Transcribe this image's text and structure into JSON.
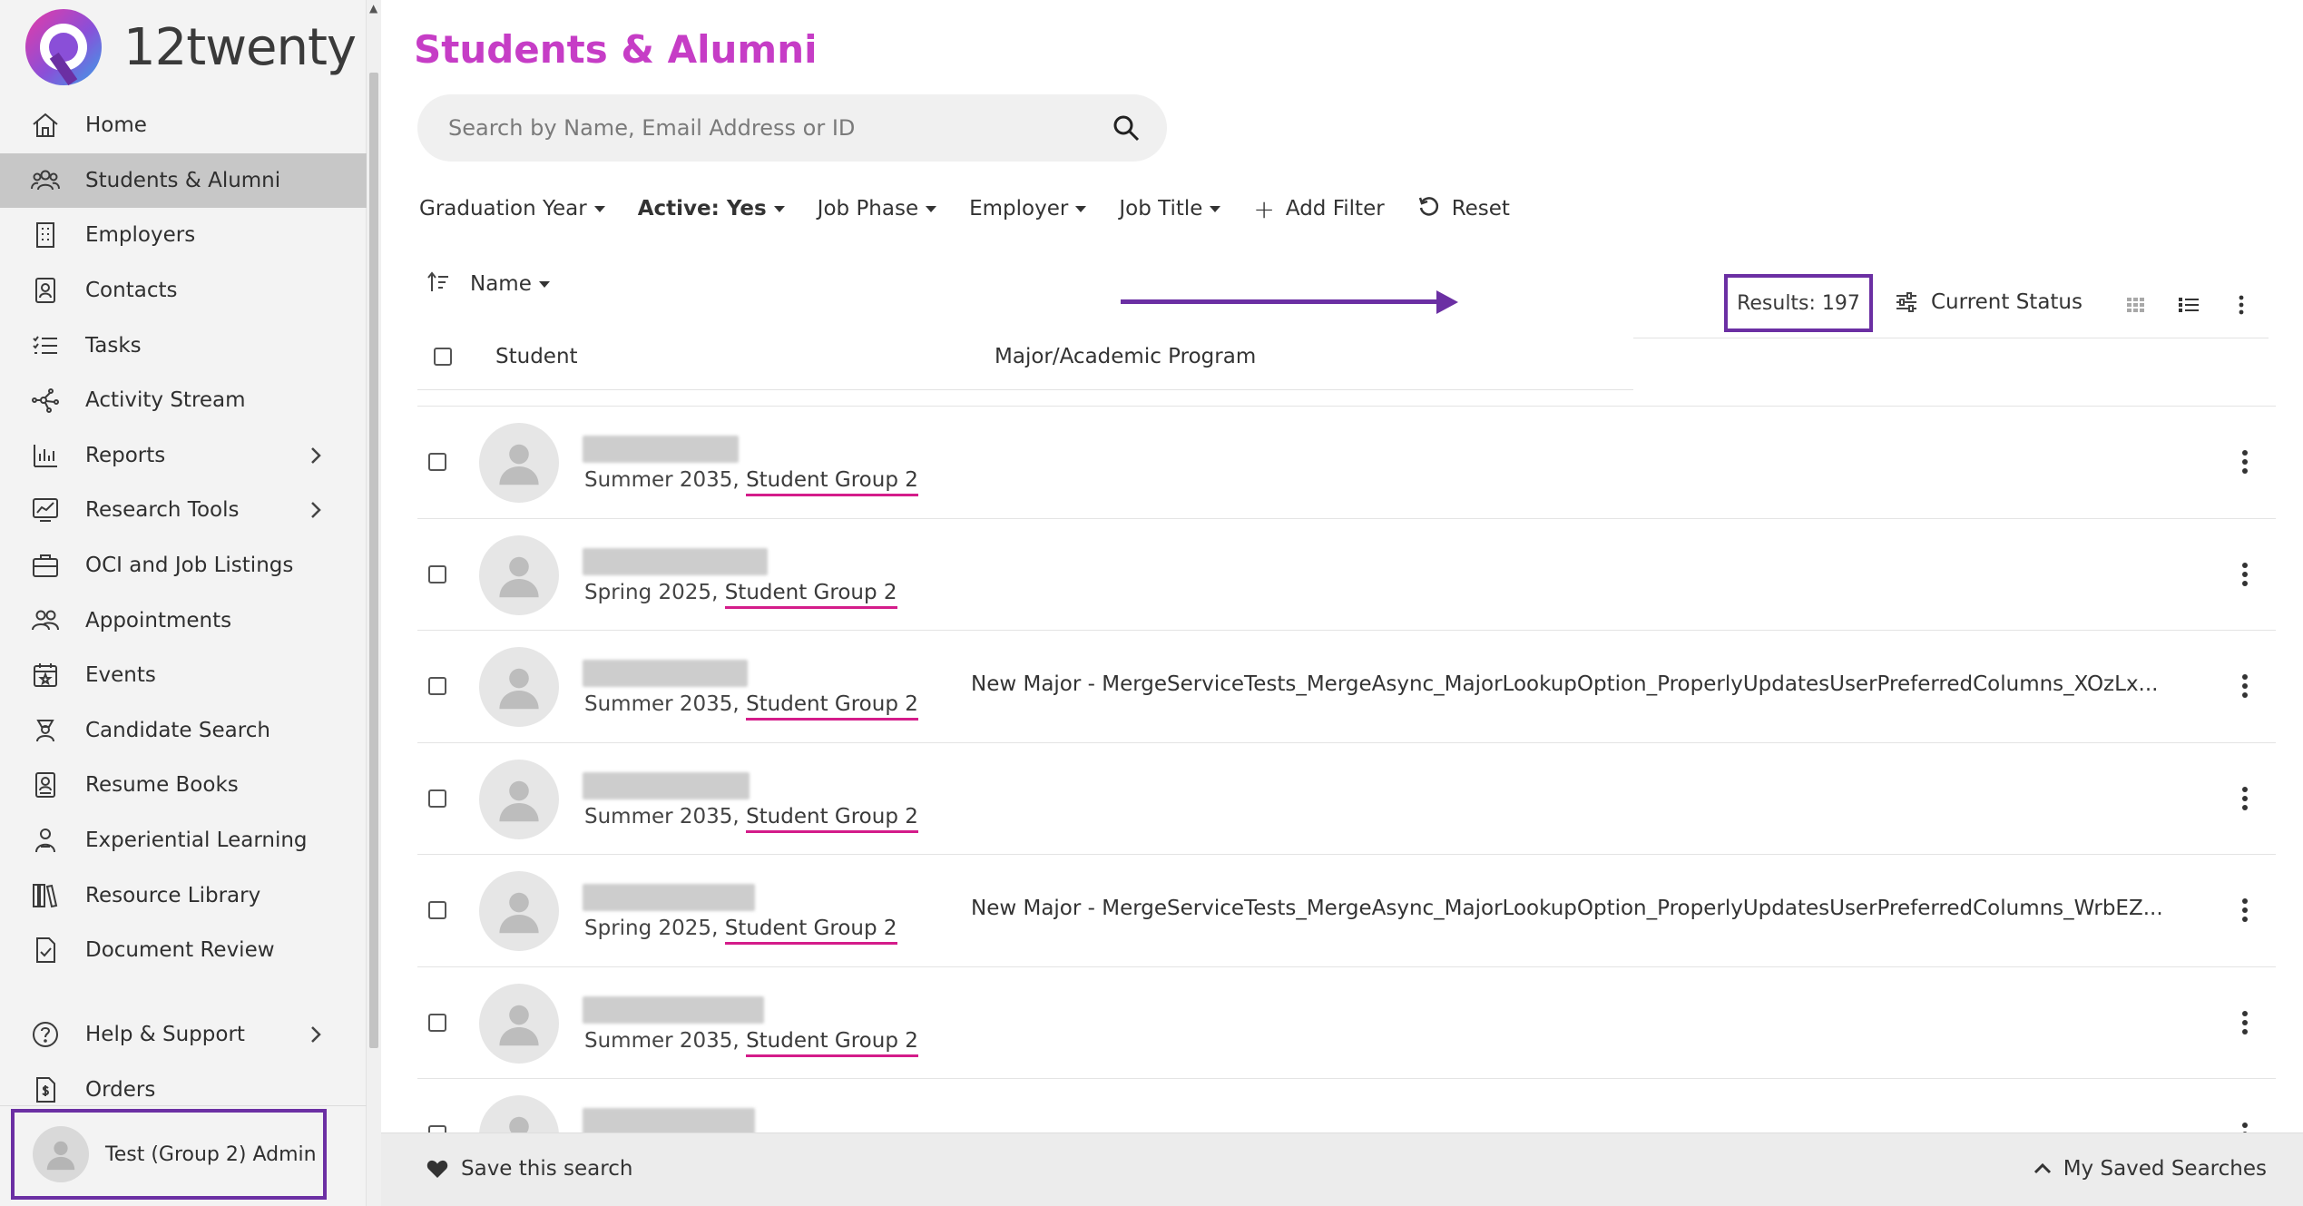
{
  "app": {
    "name": "12twenty",
    "brand_color": "#c63dc6",
    "annotation_color": "#6b2fa3"
  },
  "sidebar": {
    "items": [
      {
        "label": "Home",
        "icon": "home-icon"
      },
      {
        "label": "Students & Alumni",
        "icon": "users-icon",
        "active": true
      },
      {
        "label": "Employers",
        "icon": "building-icon"
      },
      {
        "label": "Contacts",
        "icon": "contact-card-icon"
      },
      {
        "label": "Tasks",
        "icon": "tasks-list-icon"
      },
      {
        "label": "Activity Stream",
        "icon": "network-icon"
      },
      {
        "label": "Reports",
        "icon": "bar-chart-icon",
        "has_children": true
      },
      {
        "label": "Research Tools",
        "icon": "trend-chart-icon",
        "has_children": true
      },
      {
        "label": "OCI and Job Listings",
        "icon": "briefcase-icon"
      },
      {
        "label": "Appointments",
        "icon": "people-icon"
      },
      {
        "label": "Events",
        "icon": "calendar-icon"
      },
      {
        "label": "Candidate Search",
        "icon": "search-person-icon"
      },
      {
        "label": "Resume Books",
        "icon": "resume-book-icon"
      },
      {
        "label": "Experiential Learning",
        "icon": "learner-icon"
      },
      {
        "label": "Resource Library",
        "icon": "library-icon"
      },
      {
        "label": "Document Review",
        "icon": "document-check-icon"
      }
    ],
    "bottom_items": [
      {
        "label": "Help & Support",
        "icon": "help-icon",
        "has_children": true
      },
      {
        "label": "Orders",
        "icon": "orders-icon"
      }
    ],
    "user": {
      "name": "Test (Group 2) Admin"
    }
  },
  "main": {
    "title": "Students & Alumni",
    "search": {
      "placeholder": "Search by Name, Email Address or ID",
      "value": ""
    },
    "filters": [
      {
        "label": "Graduation Year",
        "bold": false
      },
      {
        "label": "Active: Yes",
        "bold": true
      },
      {
        "label": "Job Phase",
        "bold": false
      },
      {
        "label": "Employer",
        "bold": false
      },
      {
        "label": "Job Title",
        "bold": false
      }
    ],
    "add_filter_label": "Add Filter",
    "reset_label": "Reset",
    "sort_label": "Name",
    "results_label": "Results: 197",
    "current_status_label": "Current Status",
    "columns": {
      "student": "Student",
      "major": "Major/Academic Program"
    },
    "rows": [
      {
        "term": "Summer 2035,",
        "group": "Student Group 2",
        "major": "",
        "blur_w": 172
      },
      {
        "term": "Spring 2025,",
        "group": "Student Group 2",
        "major": "",
        "blur_w": 204
      },
      {
        "term": "Summer 2035,",
        "group": "Student Group 2",
        "major": "New Major - MergeServiceTests_MergeAsync_MajorLookupOption_ProperlyUpdatesUserPreferredColumns_XOzLx...",
        "blur_w": 182
      },
      {
        "term": "Summer 2035,",
        "group": "Student Group 2",
        "major": "",
        "blur_w": 184
      },
      {
        "term": "Spring 2025,",
        "group": "Student Group 2",
        "major": "New Major - MergeServiceTests_MergeAsync_MajorLookupOption_ProperlyUpdatesUserPreferredColumns_WrbEZ...",
        "blur_w": 190
      },
      {
        "term": "Summer 2035,",
        "group": "Student Group 2",
        "major": "",
        "blur_w": 200
      },
      {
        "term": "",
        "group": "",
        "major": "",
        "blur_w": 190
      }
    ]
  },
  "footer": {
    "save_search_label": "Save this search",
    "saved_searches_label": "My Saved Searches"
  }
}
